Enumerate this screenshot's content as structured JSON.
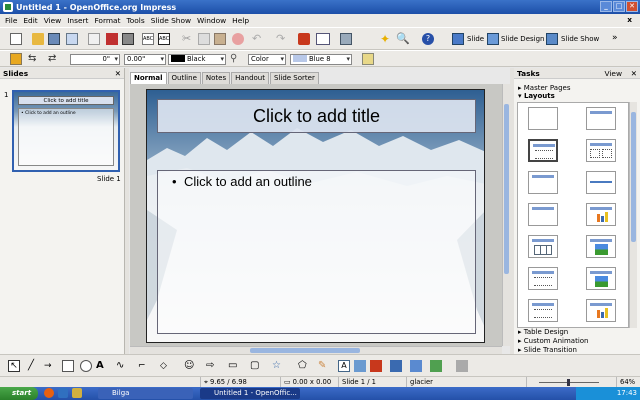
{
  "window": {
    "title": "Untitled 1 - OpenOffice.org Impress"
  },
  "menu": [
    "File",
    "Edit",
    "View",
    "Insert",
    "Format",
    "Tools",
    "Slide Show",
    "Window",
    "Help"
  ],
  "menu_close": "x",
  "toolbar": {
    "slide_btn": "Slide",
    "design_btn": "Slide Design",
    "show_btn": "Slide Show"
  },
  "line_toolbar": {
    "width": "0\"",
    "line_width": "0.00\"",
    "line_color": "Black",
    "area": "Color",
    "fill": "Blue 8"
  },
  "slides_pane": {
    "title": "Slides",
    "number": "1",
    "caption": "Slide 1"
  },
  "thumb": {
    "title": "Click to add title",
    "outline": "• Click to add an outline"
  },
  "tabs": [
    "Normal",
    "Outline",
    "Notes",
    "Handout",
    "Slide Sorter"
  ],
  "slide": {
    "title": "Click to add title",
    "outline": "Click to add an outline"
  },
  "tasks_pane": {
    "title": "Tasks",
    "view": "View",
    "master": "Master Pages",
    "layouts": "Layouts",
    "table": "Table Design",
    "anim": "Custom Animation",
    "transition": "Slide Transition"
  },
  "status": {
    "pos": "9.65 / 6.98",
    "size": "0.00 x 0.00",
    "slide": "Slide 1 / 1",
    "master": "glacier",
    "zoom": "64%"
  },
  "taskbar": {
    "start": "start",
    "task1": "Bilga",
    "task2": "Untitled 1 - OpenOffic...",
    "clock": "17:43"
  }
}
